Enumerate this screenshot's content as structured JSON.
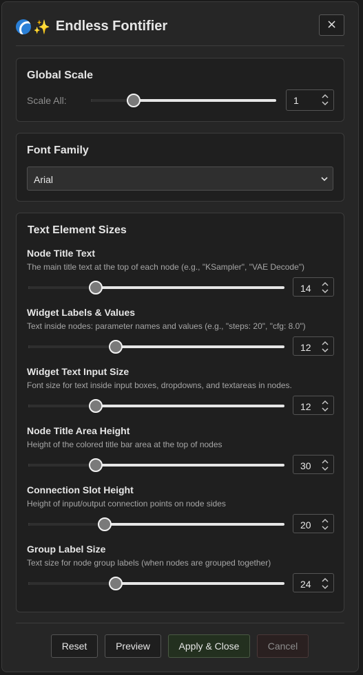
{
  "header": {
    "title": "Endless Fontifier",
    "icons": [
      "wave-icon",
      "sparkles-icon"
    ],
    "close_label": "×"
  },
  "global_scale": {
    "heading": "Global Scale",
    "label": "Scale All:",
    "value": "1"
  },
  "font_family": {
    "heading": "Font Family",
    "selected": "Arial"
  },
  "text_sizes": {
    "heading": "Text Element Sizes",
    "items": [
      {
        "title": "Node Title Text",
        "desc": "The main title text at the top of each node (e.g., \"KSampler\", \"VAE Decode\")",
        "value": "14"
      },
      {
        "title": "Widget Labels & Values",
        "desc": "Text inside nodes: parameter names and values (e.g., \"steps: 20\", \"cfg: 8.0\")",
        "value": "12"
      },
      {
        "title": "Widget Text Input Size",
        "desc": "Font size for text inside input boxes, dropdowns, and textareas in nodes.",
        "value": "12"
      },
      {
        "title": "Node Title Area Height",
        "desc": "Height of the colored title bar area at the top of nodes",
        "value": "30"
      },
      {
        "title": "Connection Slot Height",
        "desc": "Height of input/output connection points on node sides",
        "value": "20"
      },
      {
        "title": "Group Label Size",
        "desc": "Text size for node group labels (when nodes are grouped together)",
        "value": "24"
      }
    ]
  },
  "footer": {
    "reset": "Reset",
    "preview": "Preview",
    "apply": "Apply & Close",
    "cancel": "Cancel"
  },
  "colors": {
    "panel": "#262626",
    "section": "#1f1f1f",
    "apply_bg": "#23301f",
    "cancel_bg": "#2a2020"
  }
}
